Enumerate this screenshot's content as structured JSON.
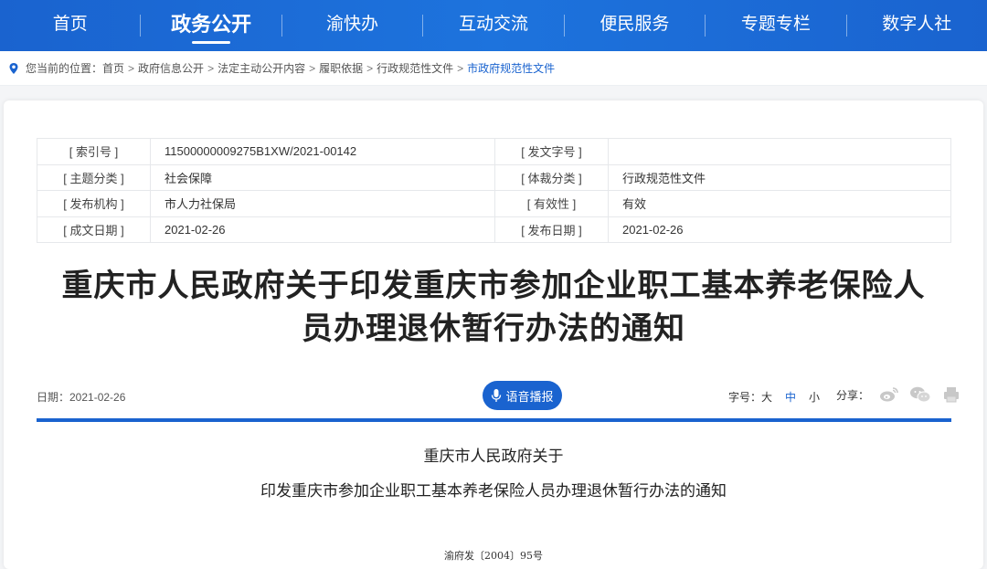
{
  "nav": {
    "items": [
      {
        "label": "首页"
      },
      {
        "label": "政务公开"
      },
      {
        "label": "渝快办"
      },
      {
        "label": "互动交流"
      },
      {
        "label": "便民服务"
      },
      {
        "label": "专题专栏"
      },
      {
        "label": "数字人社"
      }
    ],
    "active_index": 1
  },
  "breadcrumb": {
    "prefix": "您当前的位置：",
    "items": [
      "首页",
      "政府信息公开",
      "法定主动公开内容",
      "履职依据",
      "行政规范性文件",
      "市政府规范性文件"
    ],
    "separator": ">"
  },
  "meta": {
    "rows": [
      {
        "l1": "[ 索引号 ]",
        "v1": "11500000009275B1XW/2021-00142",
        "l2": "[ 发文字号 ]",
        "v2": ""
      },
      {
        "l1": "[ 主题分类 ]",
        "v1": "社会保障",
        "l2": "[ 体裁分类 ]",
        "v2": "行政规范性文件"
      },
      {
        "l1": "[ 发布机构 ]",
        "v1": "市人力社保局",
        "l2": "[ 有效性 ]",
        "v2": "有效"
      },
      {
        "l1": "[ 成文日期 ]",
        "v1": "2021-02-26",
        "l2": "[ 发布日期 ]",
        "v2": "2021-02-26"
      }
    ]
  },
  "article": {
    "headline_line1": "重庆市人民政府关于印发重庆市参加企业职工基本养老保险人",
    "headline_line2": "员办理退休暂行办法的通知",
    "date_label": "日期：2021-02-26",
    "voice_label": "语音播报",
    "fontsize_label": "字号：",
    "fontsize_options": [
      "大",
      "中",
      "小"
    ],
    "fontsize_selected": 1,
    "share_label": "分享：",
    "share_icons": [
      "weibo-icon",
      "wechat-icon",
      "print-icon"
    ],
    "doc_title_line1": "重庆市人民政府关于",
    "doc_title_line2": "印发重庆市参加企业职工基本养老保险人员办理退休暂行办法的通知",
    "doc_ref": "渝府发〔2004〕95号"
  },
  "colors": {
    "brand": "#1a63cf",
    "nav_bg": "#1d73dd",
    "backdrop": "#f4f5f7"
  }
}
